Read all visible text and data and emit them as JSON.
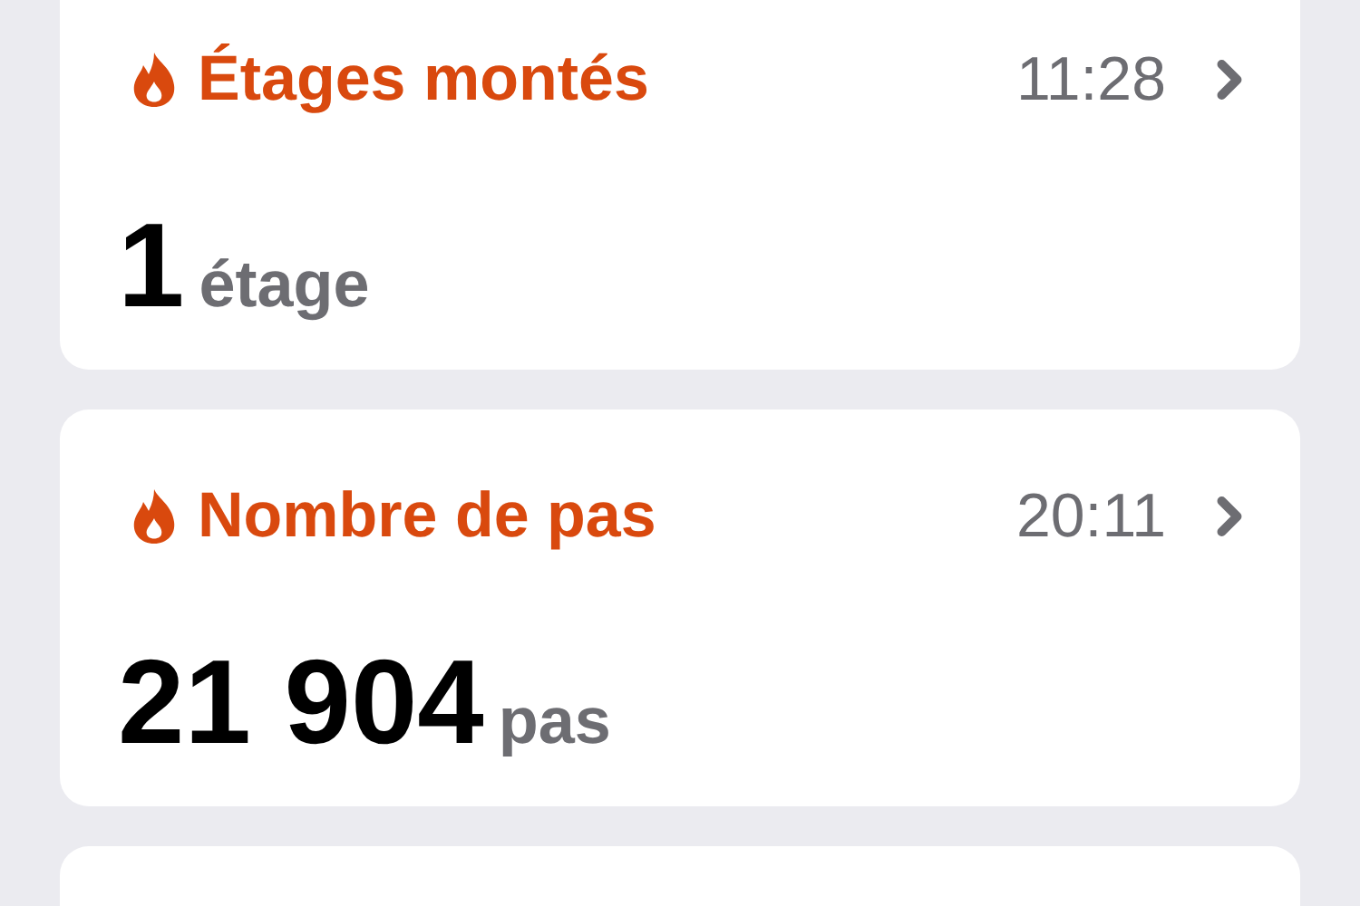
{
  "cards": [
    {
      "title": "Étages montés",
      "time": "11:28",
      "value": "1",
      "unit": "étage"
    },
    {
      "title": "Nombre de pas",
      "time": "20:11",
      "value": "21 904",
      "unit": "pas"
    }
  ]
}
